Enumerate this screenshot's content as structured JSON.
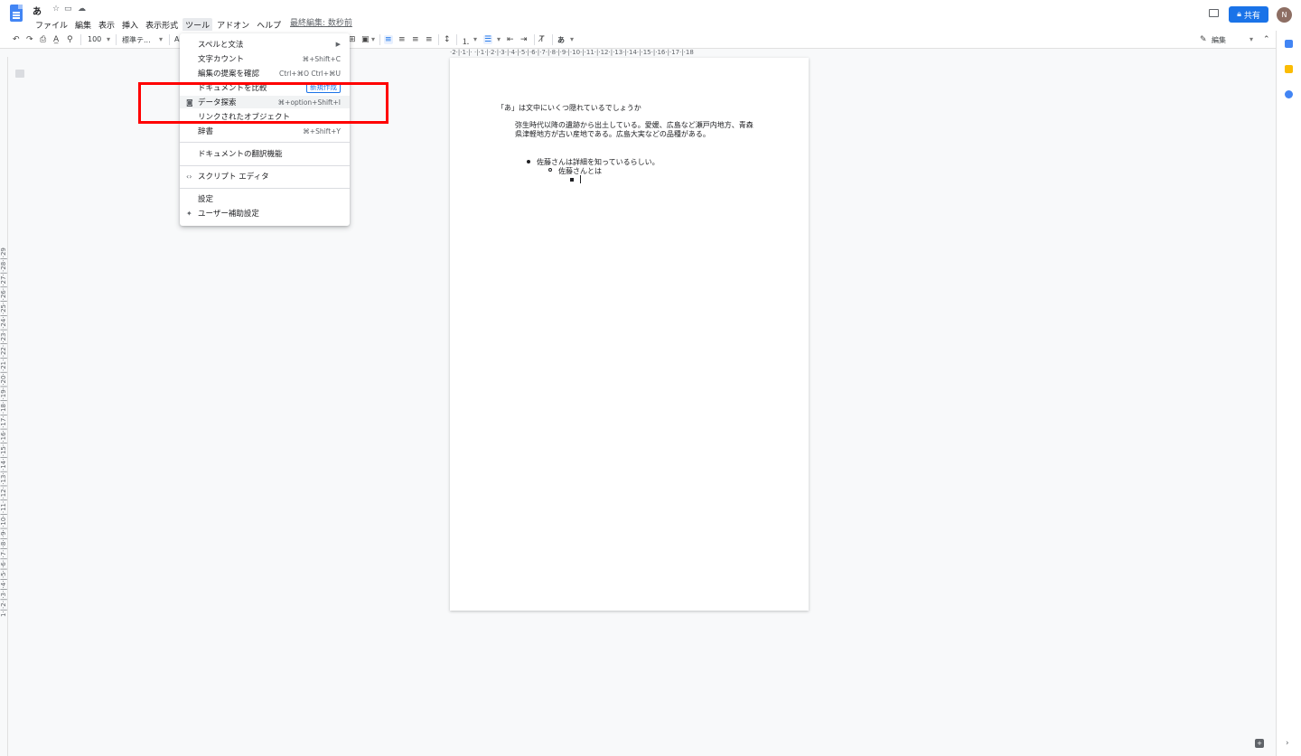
{
  "header": {
    "doc_title": "あ",
    "menus": [
      "ファイル",
      "編集",
      "表示",
      "挿入",
      "表示形式",
      "ツール",
      "アドオン",
      "ヘルプ"
    ],
    "last_edit": "最終編集: 数秒前",
    "share_label": "共有",
    "avatar_initial": "N"
  },
  "toolbar": {
    "zoom": "100",
    "style": "標準テ...",
    "font_abbrev": "A",
    "input_tool": "あ",
    "edit_mode": "編集"
  },
  "ruler": {
    "horizontal": "·2·|·1·|·  ·|·1·|·2·|·3·|·4·|·5·|·6·|·7·|·8·|·9·|·10·|·11·|·12·|·13·|·14·|·15·|·16·|·17·|·18",
    "vertical": "1·|·2·|·3·|·4·|·5·|·6·|·7·|·8·|·9·|·10·|·11·|·12·|·13·|·14·|·15·|·16·|·17·|·18·|·19·|·20·|·21·|·22·|·23·|·24·|·25·|·26·|·27·|·28·|·29"
  },
  "document": {
    "heading": "「あ」は文中にいくつ隠れているでしょうか",
    "paragraph": "弥生時代以降の遺跡から出土している。愛媛、広島など瀬戸内地方、青森県津軽地方が古い産地である。広島大実などの品種がある。",
    "bullet1": "佐藤さんは詳細を知っているらしい。",
    "bullet2": "佐藤さんとは"
  },
  "tools_menu": {
    "spelling": "スペルと文法",
    "word_count": "文字カウント",
    "word_count_shortcut": "⌘+Shift+C",
    "review_edits": "編集の提案を確認",
    "review_edits_shortcut": "Ctrl+⌘O Ctrl+⌘U",
    "compare_docs": "ドキュメントを比較",
    "compare_badge": "新規作成",
    "explore": "データ探索",
    "explore_shortcut": "⌘+option+Shift+I",
    "linked_objects": "リンクされたオブジェクト",
    "dictionary": "辞書",
    "dictionary_shortcut": "⌘+Shift+Y",
    "translate": "ドキュメントの翻訳機能",
    "script_editor": "スクリプト エディタ",
    "preferences": "設定",
    "accessibility": "ユーザー補助設定"
  },
  "colors": {
    "highlight": "#ff0000",
    "accent": "#1a73e8"
  }
}
